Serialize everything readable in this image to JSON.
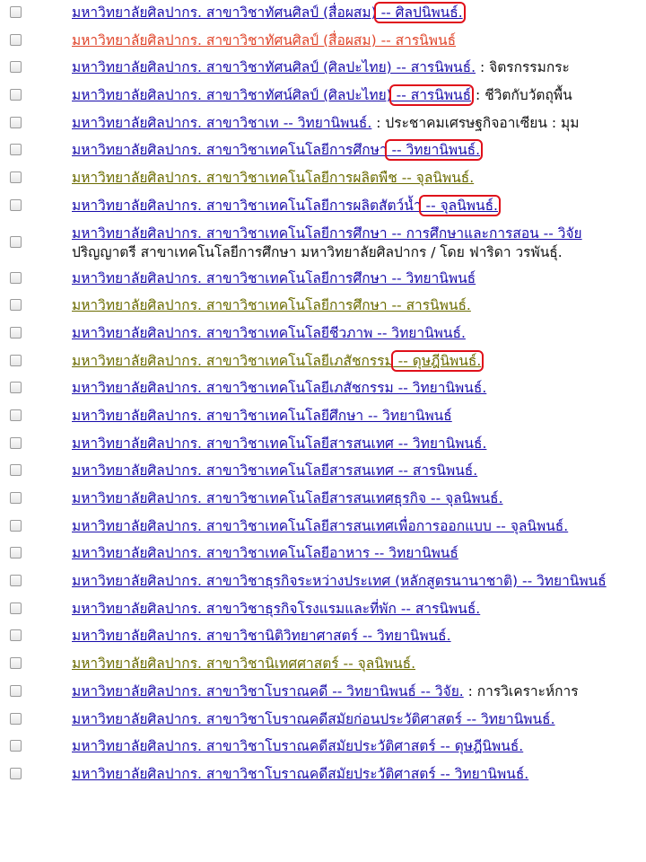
{
  "results": [
    {
      "base": "มหาวิทยาลัยศิลปากร. สาขาวิชาทัศนศิลป์ (สื่อผสม)",
      "type": " -- ศิลปนิพนธ์.",
      "color": "blue",
      "highlight": true
    },
    {
      "base": "มหาวิทยาลัยศิลปากร. สาขาวิชาทัศนศิลป์ (สื่อผสม) -- สารนิพนธ์",
      "color": "red"
    },
    {
      "base": "มหาวิทยาลัยศิลปากร. สาขาวิชาทัศนศิลป์ (ศิลปะไทย) -- สารนิพนธ์.",
      "title": " : จิตรกรรมกระ",
      "color": "blue"
    },
    {
      "base": "มหาวิทยาลัยศิลปากร. สาขาวิชาทัศน์ศิลป์ (ศิลปะไทย)",
      "type": " -- สารนิพนธ์",
      "title": " : ชีวิตกับวัตถุพื้น",
      "color": "blue",
      "highlight": true
    },
    {
      "base": "มหาวิทยาลัยศิลปากร. สาขาวิชาเท -- วิทยานิพนธ์.",
      "title": " : ประชาคมเศรษฐกิจอาเซียน : มุม",
      "color": "blue"
    },
    {
      "base": "มหาวิทยาลัยศิลปากร. สาขาวิชาเทคโนโลยีการศึกษา",
      "type": " -- วิทยานิพนธ์.",
      "color": "blue",
      "highlight": true
    },
    {
      "base": "มหาวิทยาลัยศิลปากร. สาขาวิชาเทคโนโลยีการผลิตพืช -- จุลนิพนธ์.",
      "color": "olive"
    },
    {
      "base": "มหาวิทยาลัยศิลปากร. สาขาวิชาเทคโนโลยีการผลิตสัตว์น้ำ",
      "type": " -- จุลนิพนธ์.",
      "color": "blue",
      "highlight": true
    },
    {
      "base": "มหาวิทยาลัยศิลปากร. สาขาวิชาเทคโนโลยีการศึกษา -- การศึกษาและการสอน -- วิจัย",
      "title": "ปริญญาตรี สาขาเทคโนโลยีการศึกษา มหาวิทยาลัยศิลปากร / โดย ฟาริดา วรพันธุ์.",
      "color": "blue",
      "tall": true
    },
    {
      "base": "มหาวิทยาลัยศิลปากร. สาขาวิชาเทคโนโลยีการศึกษา -- วิทยานิพนธ์",
      "color": "blue"
    },
    {
      "base": "มหาวิทยาลัยศิลปากร. สาขาวิชาเทคโนโลยีการศึกษา -- สารนิพนธ์.",
      "color": "olive"
    },
    {
      "base": "มหาวิทยาลัยศิลปากร. สาขาวิชาเทคโนโลยีชีวภาพ -- วิทยานิพนธ์.",
      "color": "blue"
    },
    {
      "base": "มหาวิทยาลัยศิลปากร. สาขาวิชาเทคโนโลยีเภสัชกรรม",
      "type": " -- ดุษฎีนิพนธ์.",
      "color": "olive",
      "highlight": true
    },
    {
      "base": "มหาวิทยาลัยศิลปากร. สาขาวิชาเทคโนโลยีเภสัชกรรม -- วิทยานิพนธ์.",
      "color": "blue"
    },
    {
      "base": "มหาวิทยาลัยศิลปากร. สาขาวิชาเทคโนโลยีศึกษา -- วิทยานิพนธ์",
      "color": "blue"
    },
    {
      "base": "มหาวิทยาลัยศิลปากร. สาขาวิชาเทคโนโลยีสารสนเทศ -- วิทยานิพนธ์.",
      "color": "blue"
    },
    {
      "base": "มหาวิทยาลัยศิลปากร. สาขาวิชาเทคโนโลยีสารสนเทศ -- สารนิพนธ์.",
      "color": "blue"
    },
    {
      "base": "มหาวิทยาลัยศิลปากร. สาขาวิชาเทคโนโลยีสารสนเทศธุรกิจ -- จุลนิพนธ์.",
      "color": "blue"
    },
    {
      "base": "มหาวิทยาลัยศิลปากร. สาขาวิชาเทคโนโลยีสารสนเทศเพื่อการออกแบบ -- จุลนิพนธ์.",
      "color": "blue"
    },
    {
      "base": "มหาวิทยาลัยศิลปากร. สาขาวิชาเทคโนโลยีอาหาร -- วิทยานิพนธ์",
      "color": "blue"
    },
    {
      "base": "มหาวิทยาลัยศิลปากร. สาขาวิชาธุรกิจระหว่างประเทศ (หลักสูตรนานาชาติ) -- วิทยานิพนธ์",
      "color": "blue"
    },
    {
      "base": "มหาวิทยาลัยศิลปากร. สาขาวิชาธุรกิจโรงแรมและที่พัก -- สารนิพนธ์.",
      "color": "blue"
    },
    {
      "base": "มหาวิทยาลัยศิลปากร. สาขาวิชานิติวิทยาศาสตร์ -- วิทยานิพนธ์.",
      "color": "blue"
    },
    {
      "base": "มหาวิทยาลัยศิลปากร. สาขาวิชานิเทศศาสตร์ -- จุลนิพนธ์.",
      "color": "olive"
    },
    {
      "base": "มหาวิทยาลัยศิลปากร. สาขาวิชาโบราณคดี -- วิทยานิพนธ์ -- วิจัย.",
      "title": " : การวิเคราะห์การ",
      "color": "blue"
    },
    {
      "base": "มหาวิทยาลัยศิลปากร. สาขาวิชาโบราณคดีสมัยก่อนประวัติศาสตร์ -- วิทยานิพนธ์.",
      "color": "blue"
    },
    {
      "base": "มหาวิทยาลัยศิลปากร. สาขาวิชาโบราณคดีสมัยประวัติศาสตร์ -- ดุษฎีนิพนธ์.",
      "color": "blue"
    },
    {
      "base": "มหาวิทยาลัยศิลปากร. สาขาวิชาโบราณคดีสมัยประวัติศาสตร์ -- วิทยานิพนธ์.",
      "color": "blue"
    }
  ]
}
